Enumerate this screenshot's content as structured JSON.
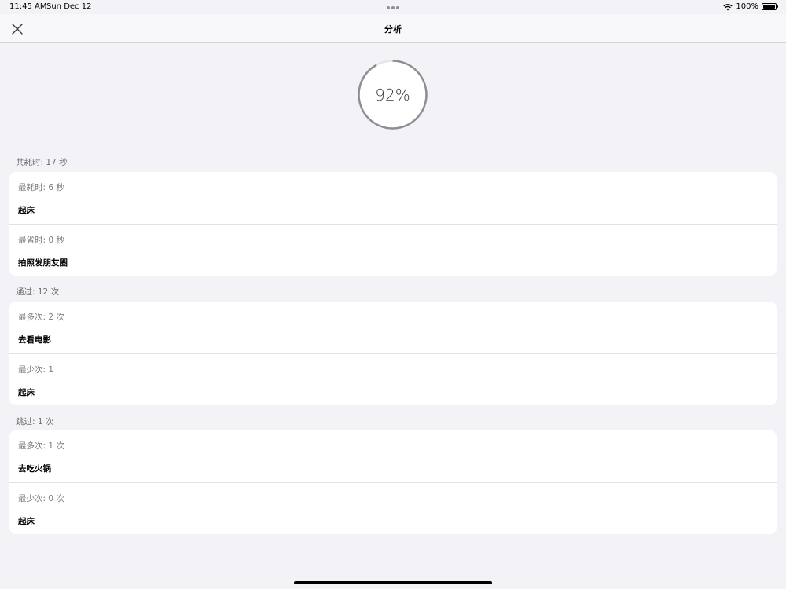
{
  "status_bar": {
    "time": "11:45 AM",
    "date": "Sun Dec 12",
    "battery": "100%"
  },
  "nav": {
    "title": "分析",
    "close_icon": "close-icon"
  },
  "progress": {
    "label": "92%",
    "value": 0.92
  },
  "sections": [
    {
      "header": "共耗时: 17 秒",
      "rows": [
        {
          "sub": "最耗时:  6 秒",
          "main": "起床"
        },
        {
          "sub": "最省时:  0 秒",
          "main": "拍照发朋友圈"
        }
      ]
    },
    {
      "header": "通过: 12 次",
      "rows": [
        {
          "sub": "最多次:  2 次",
          "main": "去看电影"
        },
        {
          "sub": "最少次:  1",
          "main": "起床"
        }
      ]
    },
    {
      "header": "跳过: 1 次",
      "rows": [
        {
          "sub": "最多次:  1 次",
          "main": "去吃火锅"
        },
        {
          "sub": "最少次:  0 次",
          "main": "起床"
        }
      ]
    }
  ],
  "colors": {
    "background": "#f2f2f7",
    "ring_track": "#e5e5ea",
    "ring_progress": "#8e8e93"
  }
}
